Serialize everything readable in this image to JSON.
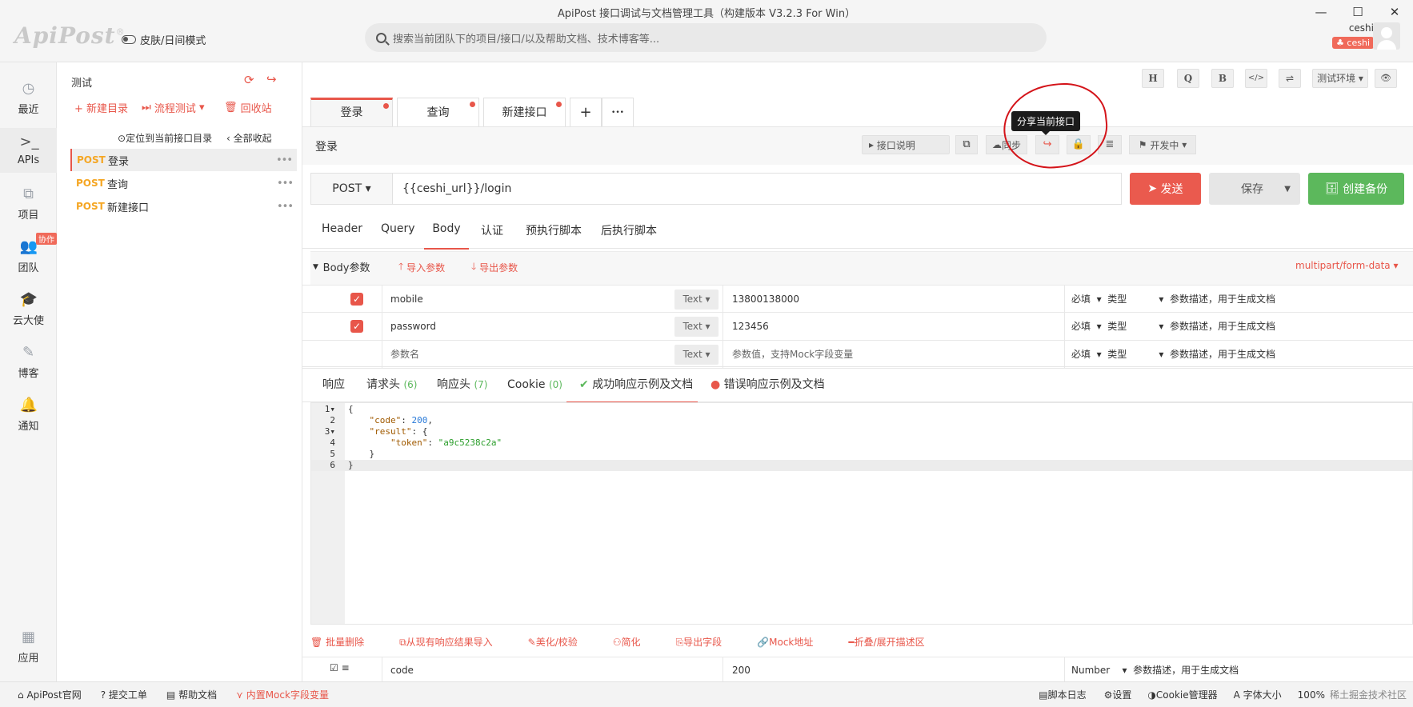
{
  "app": {
    "title": "ApiPost 接口调试与文档管理工具（构建版本 V3.2.3 For Win）",
    "logo": "ApiPost",
    "logo_mark": "®",
    "skin_mode": "皮肤/日间模式",
    "search_placeholder": "搜索当前团队下的项目/接口/以及帮助文档、技术博客等...",
    "window_controls": [
      "—",
      "☐",
      "✕"
    ],
    "user_name": "ceshi",
    "user_badge": "ceshi"
  },
  "leftnav": {
    "items": [
      {
        "label": "最近",
        "icon": "clock-icon"
      },
      {
        "label": "APIs",
        "icon": "terminal-icon"
      },
      {
        "label": "项目",
        "icon": "project-icon"
      },
      {
        "label": "团队",
        "icon": "team-icon"
      },
      {
        "label": "云大使",
        "icon": "graduation-cap-icon"
      },
      {
        "label": "博客",
        "icon": "edit-icon"
      },
      {
        "label": "通知",
        "icon": "bell-icon"
      },
      {
        "label": "应用",
        "icon": "apps-grid-icon"
      }
    ],
    "collab_badge": "协作"
  },
  "tree": {
    "project_name": "测试",
    "new_dir": "+ 新建目录",
    "flow_test": "流程测试",
    "recycle": "回收站",
    "locate": "定位到当前接口目录",
    "collapse_all": "全部收起",
    "items": [
      {
        "method": "POST",
        "name": "登录"
      },
      {
        "method": "POST",
        "name": "查询"
      },
      {
        "method": "POST",
        "name": "新建接口"
      }
    ]
  },
  "toolbar": {
    "h": "H",
    "q": "Q",
    "b": "B",
    "code": "</>",
    "sliders": "⇌",
    "env": "测试环境",
    "eye": "👁"
  },
  "tabs": [
    {
      "label": "登录"
    },
    {
      "label": "查询"
    },
    {
      "label": "新建接口"
    }
  ],
  "tab_add": "+",
  "tab_more": "•••",
  "request": {
    "name": "登录",
    "doc_btn": "接口说明",
    "sync_btn": "同步",
    "tooltip": "分享当前接口",
    "status": "开发中",
    "method": "POST",
    "url": "{{ceshi_url}}/login",
    "send": "发送",
    "save": "保存",
    "backup": "创建备份"
  },
  "subtabs": [
    "Header",
    "Query",
    "Body",
    "认证",
    "预执行脚本",
    "后执行脚本"
  ],
  "body": {
    "title": "Body参数",
    "import": "导入参数",
    "export": "导出参数",
    "content_type": "multipart/form-data",
    "rows": [
      {
        "checked": true,
        "name": "mobile",
        "type": "Text",
        "value": "13800138000",
        "required": "必填",
        "ptype": "类型",
        "desc": "参数描述，用于生成文档"
      },
      {
        "checked": true,
        "name": "password",
        "type": "Text",
        "value": "123456",
        "required": "必填",
        "ptype": "类型",
        "desc": "参数描述，用于生成文档"
      },
      {
        "checked": false,
        "name": "参数名",
        "type": "Text",
        "value": "参数值，支持Mock字段变量",
        "required": "必填",
        "ptype": "类型",
        "desc": "参数描述，用于生成文档"
      }
    ]
  },
  "response": {
    "tabs": [
      "响应",
      "请求头",
      "响应头",
      "Cookie",
      "成功响应示例及文档",
      "错误响应示例及文档"
    ],
    "counts": [
      "(6)",
      "(7)",
      "(0)"
    ],
    "code_lines": [
      {
        "n": "1",
        "fold": "▾",
        "text": "{"
      },
      {
        "n": "2",
        "fold": "",
        "key": "\"code\"",
        "sep": ": ",
        "val": "200",
        "vtype": "num",
        "tail": ","
      },
      {
        "n": "3",
        "fold": "▾",
        "key": "\"result\"",
        "sep": ": ",
        "val": "{",
        "vtype": "plain",
        "tail": ""
      },
      {
        "n": "4",
        "fold": "",
        "key": "\"token\"",
        "sep": ": ",
        "val": "\"a9c5238c2a\"",
        "vtype": "str",
        "tail": ""
      },
      {
        "n": "5",
        "fold": "",
        "text": "    }"
      },
      {
        "n": "6",
        "fold": "",
        "text": "}"
      }
    ],
    "tools": [
      "批量删除",
      "从现有响应结果导入",
      "美化/校验",
      "简化",
      "导出字段",
      "Mock地址",
      "折叠/展开描述区"
    ],
    "table_row": {
      "name": "code",
      "value": "200",
      "type": "Number",
      "desc": "参数描述，用于生成文档"
    }
  },
  "statusbar": {
    "left": [
      "ApiPost官网",
      "提交工单",
      "帮助文档",
      "内置Mock字段变量"
    ],
    "right": [
      "脚本日志",
      "设置",
      "Cookie管理器",
      "字体大小",
      "100%",
      "稀土掘金技术社区"
    ]
  }
}
